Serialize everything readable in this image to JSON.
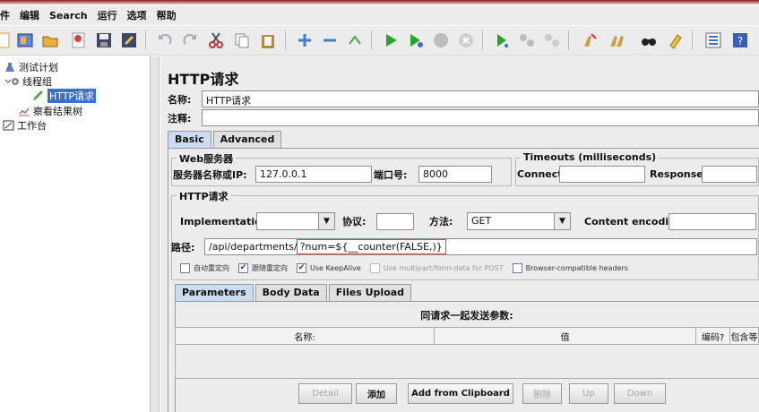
{
  "menu": [
    "件",
    "编辑",
    "Search",
    "运行",
    "选项",
    "帮助"
  ],
  "toolbar_icons": [
    "new-icon",
    "templates-icon",
    "open-icon",
    "open-recent-icon",
    "save-icon",
    "save-as-icon",
    "undo-icon",
    "redo-icon",
    "cut-icon",
    "copy-icon",
    "paste-icon",
    "expand-icon",
    "collapse-icon",
    "toggle-icon",
    "start-icon",
    "start-no-pause-icon",
    "stop-icon",
    "shutdown-icon",
    "remote-start-icon",
    "remote-stop-icon",
    "remote-shutdown-icon",
    "clear-icon",
    "clear-all-icon",
    "search-icon",
    "reset-search-icon",
    "function-helper-icon",
    "help-icon"
  ],
  "tree": {
    "test_plan": "测试计划",
    "thread_group": "线程组",
    "http_request": "HTTP请求",
    "results_tree": "察看结果树",
    "workbench": "工作台"
  },
  "panel": {
    "title": "HTTP请求",
    "name_label": "名称:",
    "name_value": "HTTP请求",
    "comment_label": "注释:",
    "tab_basic": "Basic",
    "tab_advanced": "Advanced",
    "web_server_title": "Web服务器",
    "server_label": "服务器名称或IP:",
    "server_value": "127.0.0.1",
    "port_label": "端口号:",
    "port_value": "8000",
    "timeouts_title": "Timeouts (milliseconds)",
    "connect_label": "Connect:",
    "response_label": "Response:",
    "http_request_title": "HTTP请求",
    "implementation_label": "Implementation:",
    "protocol_label": "协议:",
    "method_label": "方法:",
    "method_value": "GET",
    "encoding_label": "Content encoding:",
    "path_label": "路径:",
    "path_value": "/api/departments/",
    "path_query": "?num=${__counter(FALSE,)}",
    "cb_auto_redirect": "自动重定向",
    "cb_follow_redirect": "跟随重定向",
    "cb_keepalive": "Use KeepAlive",
    "cb_multipart": "Use multipart/form-data for POST",
    "cb_browser_headers": "Browser-compatible headers",
    "subtab_parameters": "Parameters",
    "subtab_body": "Body Data",
    "subtab_files": "Files Upload",
    "params_caption": "同请求一起发送参数:",
    "col_name": "名称:",
    "col_value": "值",
    "col_encode": "编码?",
    "col_include": "包含等",
    "btn_detail": "Detail",
    "btn_add": "添加",
    "btn_clipboard": "Add from Clipboard",
    "btn_delete": "删除",
    "btn_up": "Up",
    "btn_down": "Down"
  },
  "colors": {
    "selection": "#3d6fc5",
    "highlight_box": "#e0474c",
    "active_tab": "#ccdcf0"
  }
}
